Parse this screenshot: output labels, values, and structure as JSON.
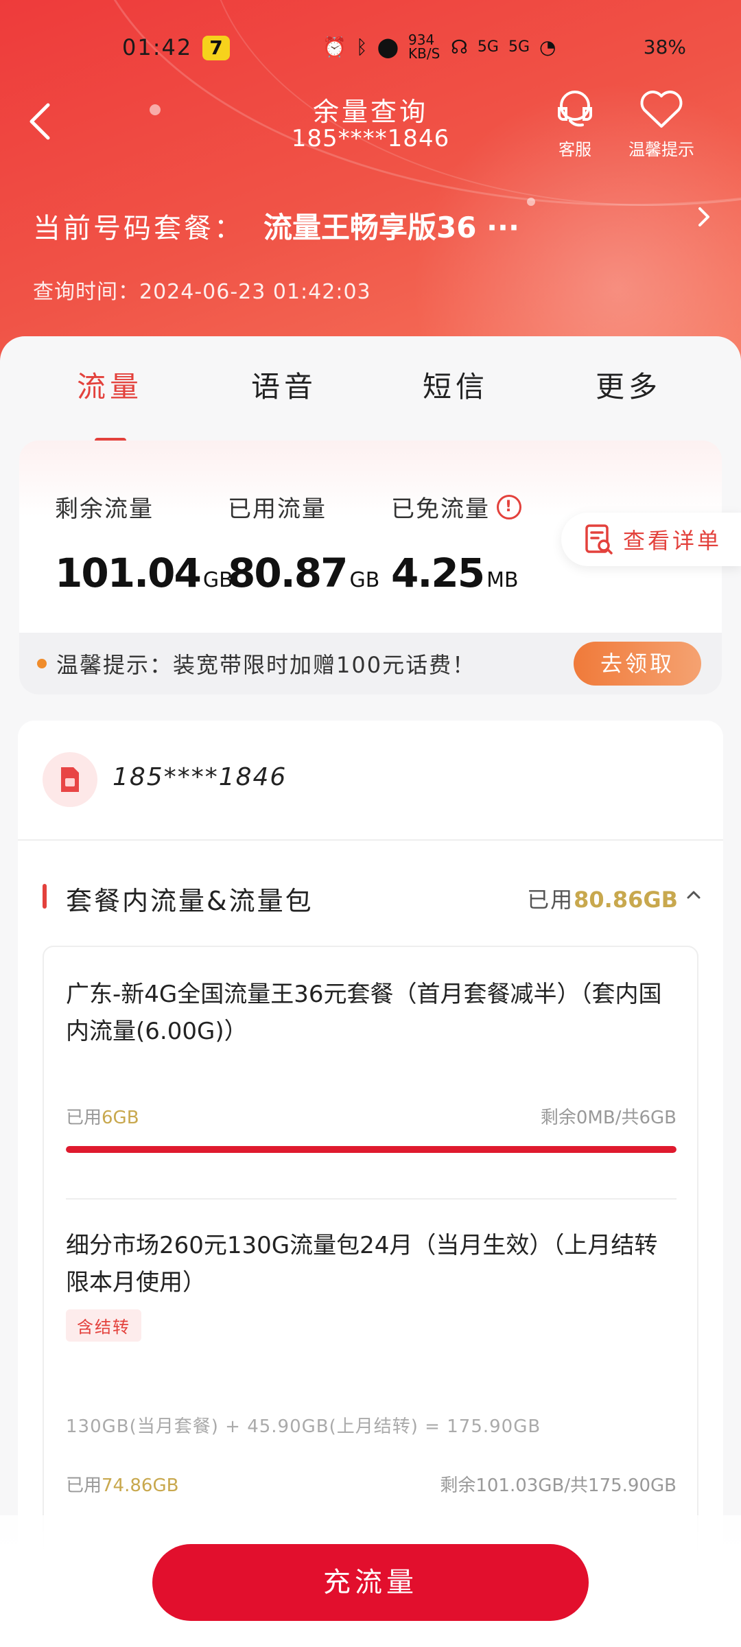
{
  "status_bar": {
    "time": "01:42",
    "app_badge": "7",
    "net_speed": "934 KB/S",
    "signal_5g_a": "5G",
    "signal_5g_b": "5G",
    "battery": "38%"
  },
  "nav": {
    "title": "余量查询",
    "phone": "185****1846",
    "service_label": "客服",
    "tips_label": "温馨提示"
  },
  "plan": {
    "label": "当前号码套餐：",
    "name": "流量王畅享版36 ···",
    "query_time": "查询时间：2024-06-23 01:42:03"
  },
  "tabs": [
    {
      "label": "流量"
    },
    {
      "label": "语音"
    },
    {
      "label": "短信"
    },
    {
      "label": "更多"
    }
  ],
  "balance": {
    "remaining_label": "剩余流量",
    "remaining_value": "101.04",
    "remaining_unit": "GB",
    "used_label": "已用流量",
    "used_value": "80.87",
    "used_unit": "GB",
    "free_label": "已免流量",
    "free_value": "4.25",
    "free_unit": "MB",
    "detail_button": "查看详单"
  },
  "tip": {
    "text": "温馨提示：装宽带限时加赠100元话费！",
    "button": "去领取"
  },
  "phone_row": {
    "number": "185****1846"
  },
  "section": {
    "title": "套餐内流量&流量包",
    "used_prefix": "已用",
    "used_amount": "80.86GB"
  },
  "packages": [
    {
      "name": "广东-新4G全国流量王36元套餐（首月套餐减半）（套内国内流量(6.00G)）",
      "used_prefix": "已用",
      "used_value": "6GB",
      "remain_text": "剩余0MB/共6GB",
      "progress": 1.0
    },
    {
      "name": "细分市场260元130G流量包24月（当月生效）（上月结转限本月使用）",
      "tag": "含结转",
      "formula": "130GB(当月套餐) + 45.90GB(上月结转) = 175.90GB",
      "used_prefix": "已用",
      "used_value": "74.86GB",
      "remain_text": "剩余101.03GB/共175.90GB"
    }
  ],
  "bottom": {
    "recharge_button": "充流量"
  },
  "colors": {
    "brand_red": "#e3413c",
    "button_red": "#e20f2d",
    "gold": "#c8a84e",
    "orange": "#f07a3a"
  }
}
